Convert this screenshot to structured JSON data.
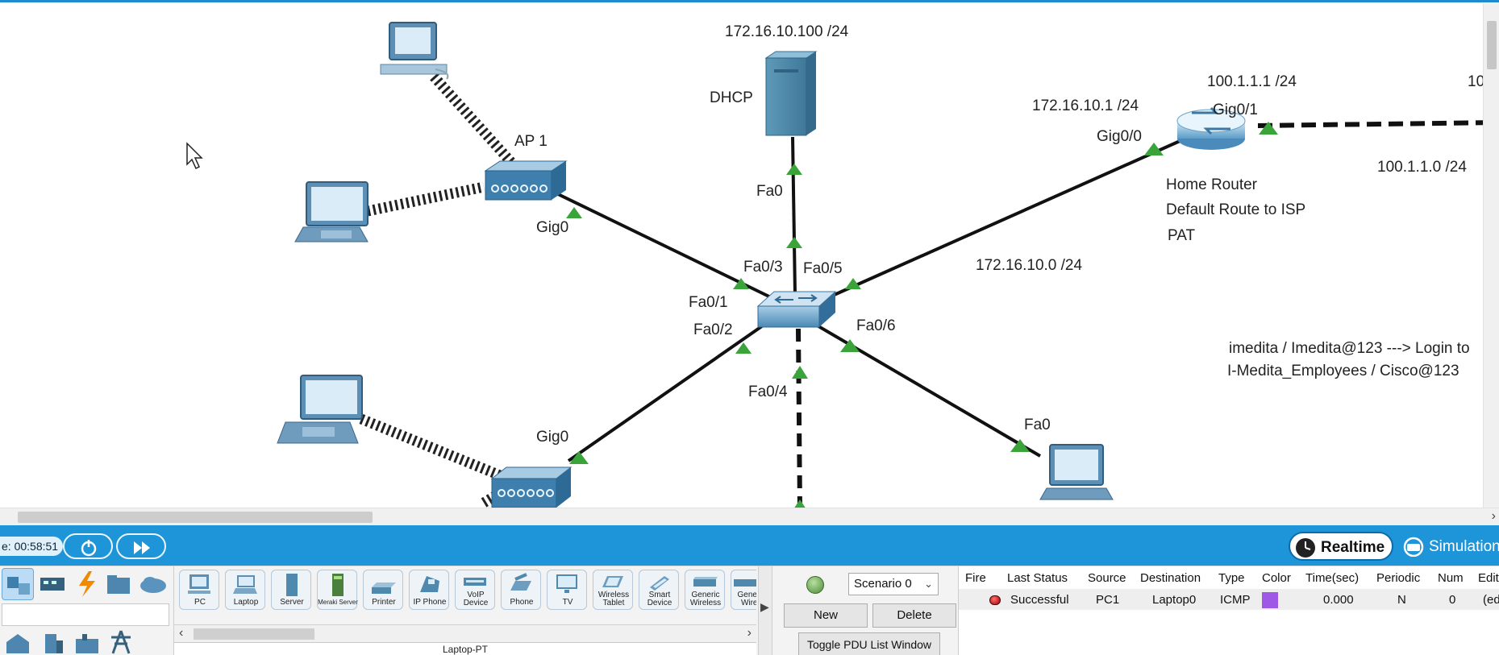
{
  "workspace": {
    "labels": {
      "dhcp_ip": "172.16.10.100 /24",
      "dhcp_name": "DHCP",
      "ap1": "AP 1",
      "gig0_top": "Gig0",
      "gig0_bottom": "Gig0",
      "fa0_server": "Fa0",
      "fa0_3": "Fa0/3",
      "fa0_5": "Fa0/5",
      "fa0_1": "Fa0/1",
      "fa0_2": "Fa0/2",
      "fa0_6": "Fa0/6",
      "fa0_4": "Fa0/4",
      "fa0_laptop": "Fa0",
      "router_lan_ip": "172.16.10.1 /24",
      "router_gig0_0": "Gig0/0",
      "router_wan_ip": "100.1.1.1 /24",
      "router_gig0_1": "Gig0/1",
      "router_name": "Home Router",
      "router_note1": "Default Route to ISP",
      "router_note2": "PAT",
      "lan_network": "172.16.10.0 /24",
      "wan_network": "100.1.1.0 /24",
      "edge_text": "10",
      "note_login": "imedita / Imedita@123 ---> Login to",
      "note_wifi": "I-Medita_Employees / Cisco@123"
    }
  },
  "realtime_bar": {
    "time": "e: 00:58:51",
    "realtime_label": "Realtime",
    "simulation_label": "Simulation"
  },
  "device_palette": {
    "devices": [
      {
        "label": "PC",
        "icon": "pc-icon"
      },
      {
        "label": "Laptop",
        "icon": "laptop-icon"
      },
      {
        "label": "Server",
        "icon": "server-icon"
      },
      {
        "label": "Meraki Server",
        "icon": "meraki-server-icon"
      },
      {
        "label": "Printer",
        "icon": "printer-icon"
      },
      {
        "label": "IP Phone",
        "icon": "ip-phone-icon"
      },
      {
        "label": "VoIP Device",
        "icon": "voip-device-icon"
      },
      {
        "label": "Phone",
        "icon": "phone-icon"
      },
      {
        "label": "TV",
        "icon": "tv-icon"
      },
      {
        "label": "Wireless Tablet",
        "icon": "tablet-icon"
      },
      {
        "label": "Smart Device",
        "icon": "smart-device-icon"
      },
      {
        "label": "Generic Wireless",
        "icon": "generic-wireless-icon"
      },
      {
        "label": "Generic Wired",
        "icon": "generic-wired-icon"
      }
    ],
    "model_name": "Laptop-PT"
  },
  "scenario": {
    "selected": "Scenario 0",
    "new_label": "New",
    "delete_label": "Delete",
    "toggle_label": "Toggle PDU List Window"
  },
  "pdu_list": {
    "headers": [
      "Fire",
      "Last Status",
      "Source",
      "Destination",
      "Type",
      "Color",
      "Time(sec)",
      "Periodic",
      "Num",
      "Edit"
    ],
    "rows": [
      {
        "last_status": "Successful",
        "source": "PC1",
        "destination": "Laptop0",
        "type": "ICMP",
        "color": "#9f58e6",
        "time": "0.000",
        "periodic": "N",
        "num": "0",
        "edit": "(edit)"
      }
    ]
  }
}
